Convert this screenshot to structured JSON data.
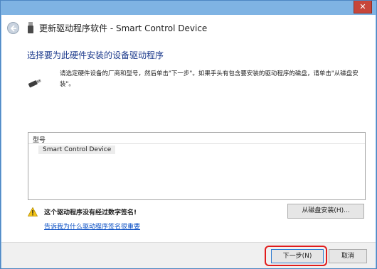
{
  "window": {
    "close_glyph": "✕"
  },
  "header": {
    "title": "更新驱动程序软件 - Smart Control Device",
    "back_icon": "back-arrow-icon",
    "device_icon": "usb-device-icon"
  },
  "main": {
    "title": "选择要为此硬件安装的设备驱动程序",
    "instruction": "请选定硬件设备的厂商和型号，然后单击\"下一步\"。如果手头有包含要安装的驱动程序的磁盘，请单击\"从磁盘安装\"。",
    "device_icon": "usb-plug-icon"
  },
  "model_list": {
    "header": "型号",
    "items": [
      "Smart Control Device"
    ]
  },
  "warning": {
    "icon": "warning-icon",
    "text": "这个驱动程序没有经过数字签名!",
    "link": "告诉我为什么驱动程序签名很重要",
    "disk_button": "从磁盘安装(H)..."
  },
  "footer": {
    "next_button": "下一步(N)",
    "cancel_button": "取消",
    "highlight_color": "#e11b1b"
  }
}
